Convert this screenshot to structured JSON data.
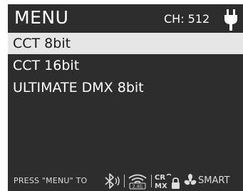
{
  "header": {
    "title": "MENU",
    "channel": "CH: 512",
    "power_icon": "plug-icon"
  },
  "menu": {
    "items": [
      {
        "label": "CCT 8bit",
        "selected": true
      },
      {
        "label": "CCT 16bit",
        "selected": false
      },
      {
        "label": "ULTIMATE DMX 8bit",
        "selected": false
      }
    ]
  },
  "footer": {
    "hint": "PRESS \"MENU\" TO",
    "icons": [
      "bluetooth-icon",
      "wireless-2g4-icon",
      "crmx-icon",
      "lock-icon",
      "fan-icon"
    ],
    "wireless_band": "2.4G",
    "crmx_label_top": "CR",
    "crmx_label_bottom": "MX",
    "mode": "SMART"
  },
  "colors": {
    "screen_bg": "#2d2d2d",
    "selected_bg": "#e6e6e6",
    "text": "#ffffff"
  }
}
